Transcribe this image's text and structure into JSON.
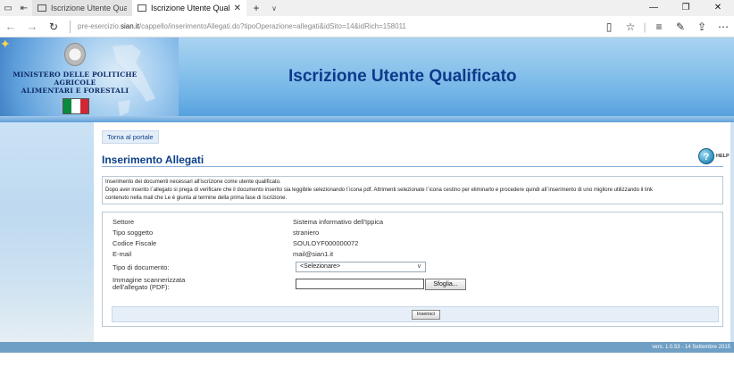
{
  "browser": {
    "tabs": [
      {
        "title": "Iscrizione Utente Qualificato",
        "active": false
      },
      {
        "title": "Iscrizione Utente Qualifi",
        "active": true
      }
    ],
    "new_tab_icon": "plus-icon",
    "url_prefix": "pre-esercizio.",
    "url_domain": "sian.it",
    "url_path": "/cappello/inserimentoAllegati.do?tipoOperazione=allegati&idSito=14&idRich=158011"
  },
  "header": {
    "ministry_line1": "MINISTERO DELLE POLITICHE AGRICOLE",
    "ministry_line2": "ALIMENTARI E FORESTALI",
    "title": "Iscrizione Utente Qualificato",
    "flag_colors": [
      "#0b8a3e",
      "#ffffff",
      "#cf2734"
    ]
  },
  "content": {
    "back_link": "Torna al portale",
    "section_title": "Inserimento Allegati",
    "help_label": "HELP",
    "info_lines": [
      "Inserimento dei documenti necessari all'iscrizione come utente qualificato.",
      "Dopo aver inserito l`allegato si prega di verificare che il documento inserito sia leggibile selezionando l`icona pdf. Altrimenti selezionate l`icona cestino per eliminarlo e procedere quindi all`inserimento di uno migliore utilizzando il link",
      "contenuto nella mail che Le è giunta al termine della prima fase di Iscrizione."
    ],
    "form": {
      "fields": [
        {
          "label": "Settore",
          "value": "Sistema informativo dell'Ippica"
        },
        {
          "label": "Tipo soggetto",
          "value": "straniero"
        },
        {
          "label": "Codice Fiscale",
          "value": "SOULOYF000000072"
        },
        {
          "label": "E-mail",
          "value": "mail@sian1.it"
        }
      ],
      "doc_type_label": "Tipo di documento:",
      "doc_type_selected": "<Selezionare>",
      "image_label_line1": "Immagine scannerizzata",
      "image_label_line2": "dell'allegato (PDF):",
      "browse_button": "Sfoglia...",
      "submit_button": "Inserisci"
    }
  },
  "footer": {
    "version": "vers. 1.0.53 - 14 Settembre 2015"
  }
}
